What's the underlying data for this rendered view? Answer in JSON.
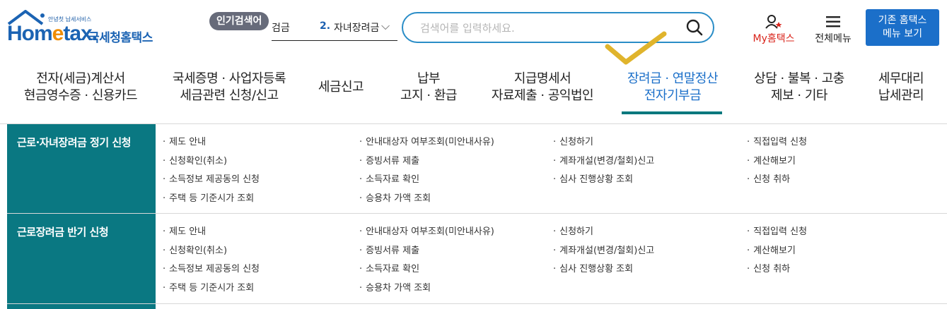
{
  "header": {
    "logo": {
      "tagline": "안녕첫 납세서비스",
      "brand_home": "Hom",
      "brand_e": "e",
      "brand_tax": "tax.",
      "name_ko": "국세청홈택스"
    },
    "popular_search": {
      "badge": "인기검색어",
      "prev_term_fragment": "검금",
      "rank": "2.",
      "term": "자녀장려금"
    },
    "search": {
      "placeholder": "검색어를 입력하세요."
    },
    "my_hometax_label": "My홈택스",
    "all_menu_label": "전체메뉴",
    "legacy_button": {
      "line1": "기존 홈택스",
      "line2": "메뉴 보기"
    },
    "accent_color": "#1b6fc9",
    "check_color": "#e0b42c"
  },
  "nav": {
    "items": [
      {
        "line1": "전자(세금)계산서",
        "line2": "현금영수증 · 신용카드"
      },
      {
        "line1": "국세증명 · 사업자등록",
        "line2": "세금관련 신청/신고"
      },
      {
        "line1": "세금신고",
        "line2": ""
      },
      {
        "line1": "납부",
        "line2": "고지 · 환급"
      },
      {
        "line1": "지급명세서",
        "line2": "자료제출 · 공익법인"
      },
      {
        "line1": "장려금 · 연말정산",
        "line2": "전자기부금"
      },
      {
        "line1": "상담 · 불복 · 고충",
        "line2": "제보 · 기타"
      },
      {
        "line1": "세무대리",
        "line2": "납세관리"
      }
    ],
    "active_index": 5,
    "active_color": "#00787e"
  },
  "submenu": {
    "category_color": "#0a7882",
    "sections": [
      {
        "title": "근로·자녀장려금 정기 신청",
        "links": [
          [
            "제도 안내",
            "신청확인(취소)",
            "소득정보 제공동의 신청",
            "주택 등 기준시가 조회"
          ],
          [
            "안내대상자 여부조회(미안내사유)",
            "증빙서류 제출",
            "소득자료 확인",
            "승용차 가액 조회"
          ],
          [
            "신청하기",
            "계좌개설(변경/철회)신고",
            "심사 진행상황 조회"
          ],
          [
            "직접입력 신청",
            "계산해보기",
            "신청 취하"
          ]
        ]
      },
      {
        "title": "근로장려금 반기 신청",
        "links": [
          [
            "제도 안내",
            "신청확인(취소)",
            "소득정보 제공동의 신청",
            "주택 등 기준시가 조회"
          ],
          [
            "안내대상자 여부조회(미안내사유)",
            "증빙서류 제출",
            "소득자료 확인",
            "승용차 가액 조회"
          ],
          [
            "신청하기",
            "계좌개설(변경/철회)신고",
            "심사 진행상황 조회"
          ],
          [
            "직접입력 신청",
            "계산해보기",
            "신청 취하"
          ]
        ]
      }
    ]
  }
}
